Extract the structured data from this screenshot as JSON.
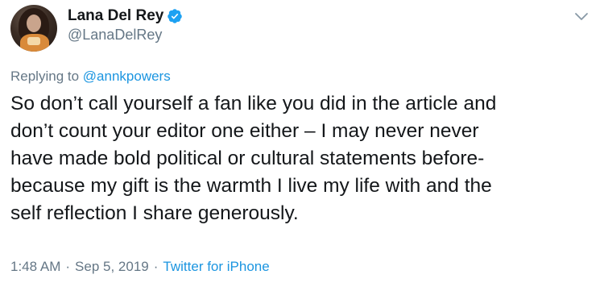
{
  "author": {
    "display_name": "Lana Del Rey",
    "handle": "@LanaDelRey",
    "verified": true
  },
  "reply": {
    "prefix": "Replying to",
    "mention": "@annkpowers"
  },
  "tweet": {
    "text": "So don’t call yourself a fan like you did in the article and\ndon’t count your editor one either – I may never never\nhave made bold political or cultural statements before-\nbecause my gift is the warmth I live my life with and the\nself reflection I share generously."
  },
  "meta": {
    "time": "1:48 AM",
    "separator": "·",
    "date": "Sep 5, 2019",
    "client": "Twitter for iPhone"
  },
  "icons": {
    "verified": "verified-badge-icon",
    "menu": "chevron-down-icon"
  },
  "colors": {
    "accent": "#1b95e0",
    "secondary_text": "#657786",
    "primary_text": "#14171a"
  }
}
